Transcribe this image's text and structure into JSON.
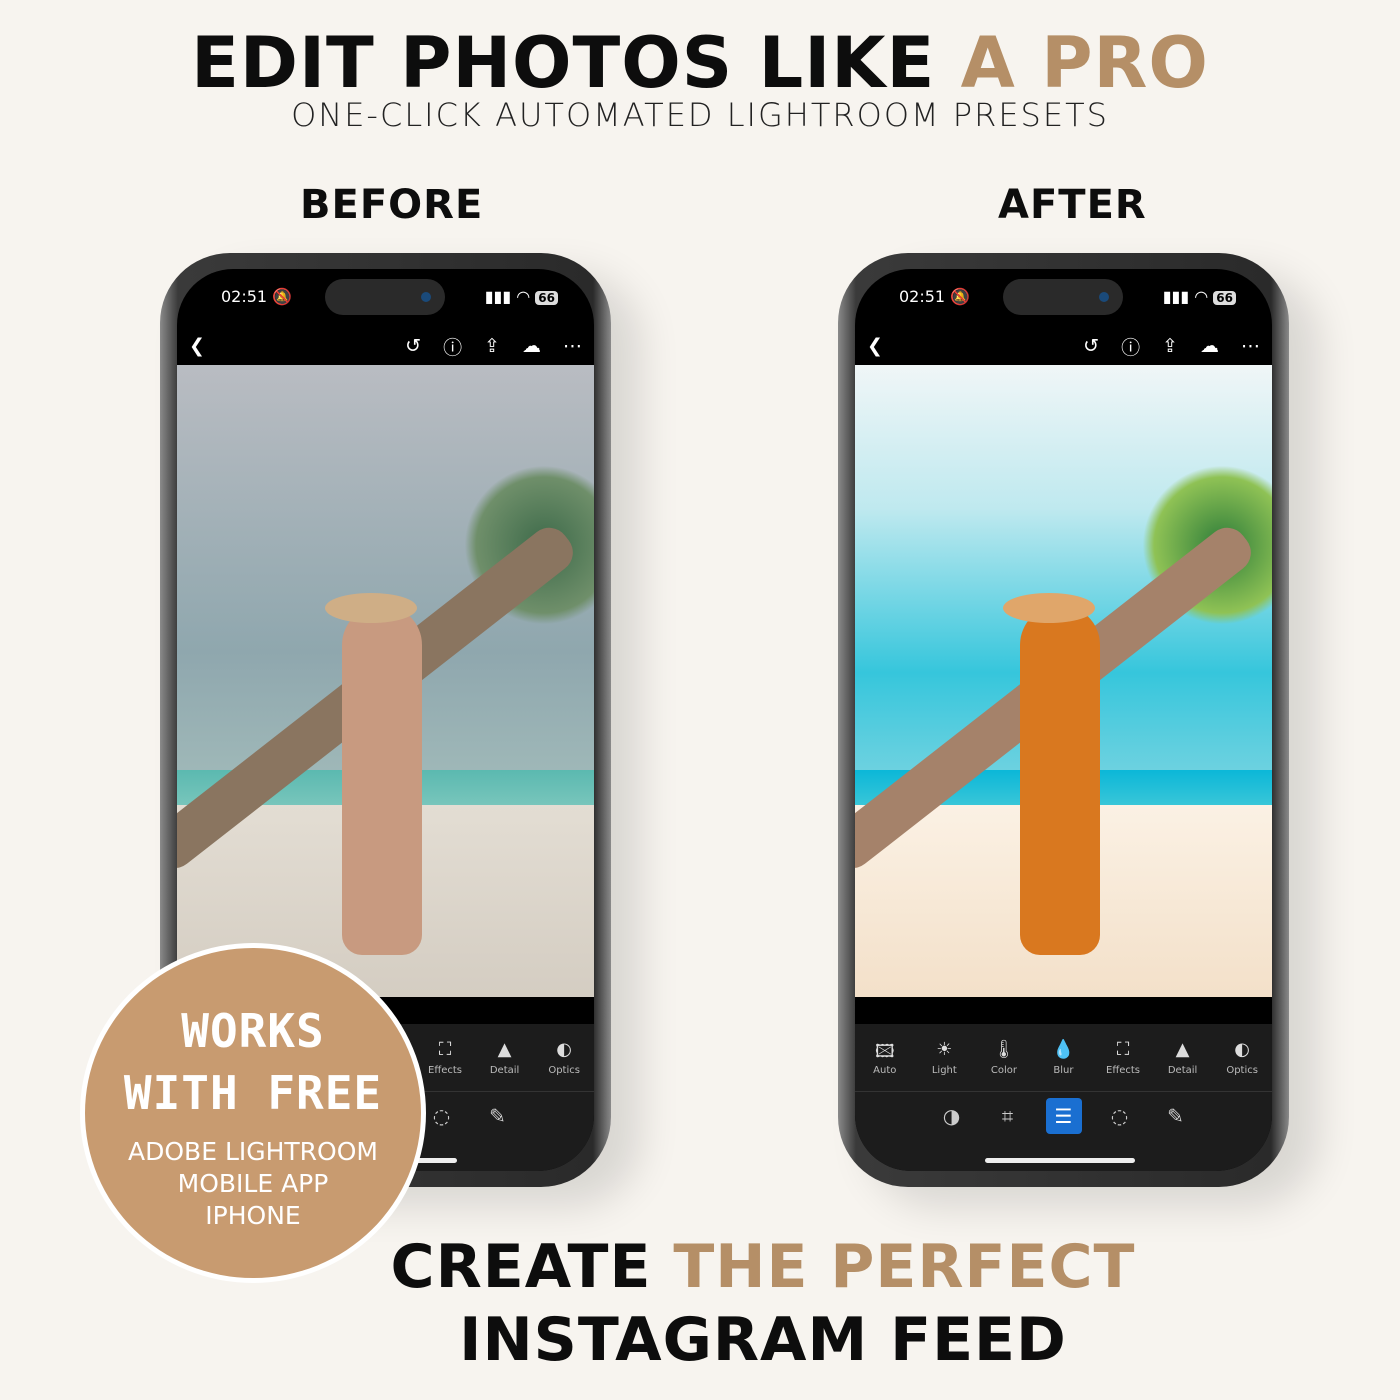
{
  "header": {
    "title_main": "EDIT PHOTOS LIKE ",
    "title_accent": "A PRO",
    "subtitle": "ONE-CLICK AUTOMATED LIGHTROOM PRESETS"
  },
  "labels": {
    "before": "BEFORE",
    "after": "AFTER"
  },
  "phone": {
    "time": "02:51",
    "battery": "66",
    "tools": [
      "Auto",
      "Light",
      "Color",
      "Blur",
      "Effects",
      "Detail",
      "Optics"
    ]
  },
  "badge": {
    "line1": "WORKS",
    "line2": "WITH FREE",
    "line3": "ADOBE LIGHTROOM",
    "line4": "MOBILE APP",
    "line5": "IPHONE"
  },
  "footer": {
    "line1_main": "CREATE ",
    "line1_accent": "THE PERFECT",
    "line2": "INSTAGRAM FEED"
  },
  "colors": {
    "accent": "#b58f67",
    "badge": "#c89b70",
    "background": "#f7f4ef",
    "active_tool": "#1a6fd1"
  }
}
